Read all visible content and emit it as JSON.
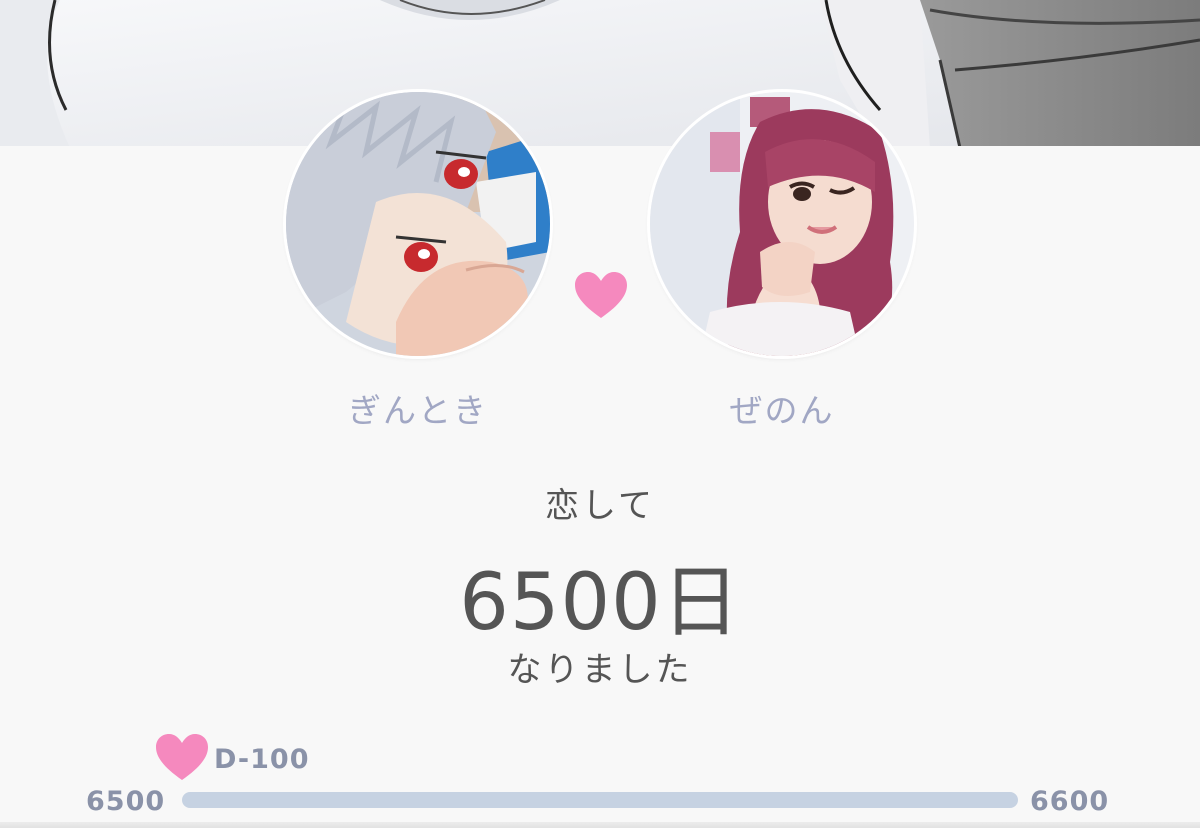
{
  "colors": {
    "accent_pink": "#f589be",
    "name_text": "#a1a7c4",
    "body_text": "#555555",
    "progress_track": "#c6d2e2",
    "progress_label": "#8a92a8"
  },
  "couple": {
    "left": {
      "name": "ぎんとき",
      "avatar": "anime-plush-photo"
    },
    "right": {
      "name": "ぜのん",
      "avatar": "pink-haired-person-photo"
    },
    "heart_icon": "heart-icon"
  },
  "counter": {
    "prefix": "恋して",
    "days": "6500日",
    "suffix": "なりました"
  },
  "progress": {
    "milestone_label": "D-100",
    "start": "6500",
    "end": "6600",
    "filled_fraction": 0
  }
}
